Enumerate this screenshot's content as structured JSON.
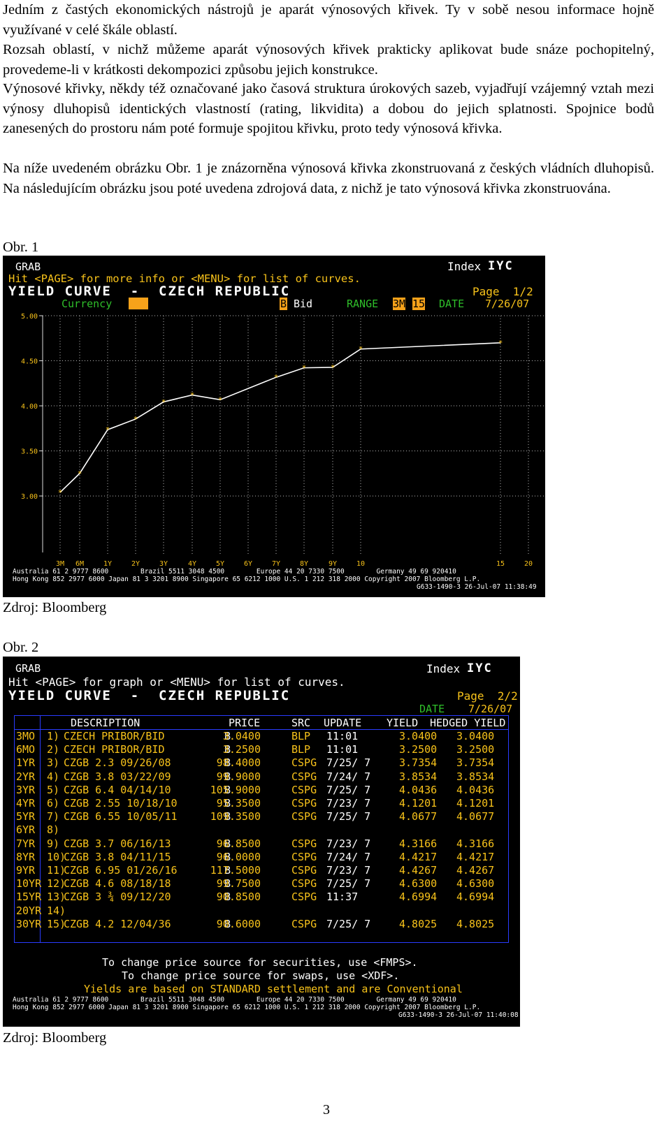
{
  "paragraphs": [
    "Jedním z častých ekonomických nástrojů je aparát výnosových křivek. Ty v sobě nesou informace hojně využívané v celé škále oblastí.",
    "Rozsah oblastí, v nichž můžeme aparát výnosových křivek prakticky aplikovat bude snáze pochopitelný, provedeme-li v krátkosti dekompozici způsobu jejich konstrukce.",
    "Výnosové křivky, někdy též označované jako časová struktura úrokových sazeb, vyjadřují vzájemný vztah mezi výnosy dluhopisů identických vlastností (rating, likvidita) a dobou do jejich splatnosti. Spojnice bodů zanesených do prostoru nám poté formuje spojitou křivku, proto tedy výnosová křivka.",
    "Na níže uvedeném obrázku Obr. 1 je znázorněna výnosová křivka zkonstruovaná z českých vládních dluhopisů. Na následujícím obrázku jsou poté uvedena zdrojová data, z nichž je tato výnosová křivka zkonstruována."
  ],
  "figure1": {
    "caption": "Obr. 1",
    "source": "Zdroj: Bloomberg",
    "grab": "GRAB",
    "index_label": "Index",
    "index_code": "IYC",
    "hint": "Hit <PAGE> for more info or <MENU> for list of curves.",
    "title": "YIELD CURVE  -  CZECH REPUBLIC",
    "currency_label": "Currency",
    "page_label": "Page  1/2",
    "bid_key": "B",
    "bid_label": "Bid",
    "range_label": "RANGE",
    "range_from": "3M",
    "range_to": "15",
    "date_label": "DATE",
    "date_value": "7/26/07",
    "footer1": "Australia 61 2 9777 8600        Brazil 5511 3048 4500        Europe 44 20 7330 7500        Germany 49 69 920410",
    "footer2": "Hong Kong 852 2977 6000 Japan 81 3 3201 8900 Singapore 65 6212 1000 U.S. 1 212 318 2000 Copyright 2007 Bloomberg L.P.",
    "footer3": "G633-1490-3 26-Jul-07 11:38:49",
    "colors": {
      "background": "#000000",
      "text": "#ffffff",
      "accent": "#f7c21a",
      "green": "#2fbf2a",
      "grid": "#b9b9b9"
    },
    "chart_data": {
      "type": "line",
      "title": "",
      "xlabel": "",
      "ylabel": "",
      "x_ticks": [
        "3M",
        "6M",
        "1Y",
        "2Y",
        "3Y",
        "4Y",
        "5Y",
        "6Y",
        "7Y",
        "8Y",
        "9Y",
        "10",
        "15",
        "20"
      ],
      "y_ticks": [
        "5.00",
        "4.50",
        "4.00",
        "3.50",
        "3.00"
      ],
      "ylim": [
        2.9,
        5.0
      ],
      "x": [
        "3M",
        "6M",
        "1Y",
        "2Y",
        "3Y",
        "4Y",
        "5Y",
        "7Y",
        "8Y",
        "9Y",
        "10",
        "15"
      ],
      "values": [
        3.04,
        3.25,
        3.7354,
        3.8534,
        4.0436,
        4.1201,
        4.0677,
        4.3166,
        4.4217,
        4.4267,
        4.63,
        4.6994
      ],
      "grid": true
    }
  },
  "figure2": {
    "caption": "Obr. 2",
    "source": "Zdroj: Bloomberg",
    "grab": "GRAB",
    "index_label": "Index",
    "index_code": "IYC",
    "hint": "Hit <PAGE> for graph or <MENU> for list of curves.",
    "title": "YIELD CURVE  -  CZECH REPUBLIC",
    "page_label": "Page  2/2",
    "date_label": "DATE",
    "date_value": "7/26/07",
    "headers": [
      "DESCRIPTION",
      "PRICE",
      "SRC",
      "UPDATE",
      "YIELD",
      "HEDGED YIELD"
    ],
    "rows": [
      {
        "term": "3MO",
        "num": "1)",
        "desc": "CZECH PRIBOR/BID",
        "b": "B",
        "price": "3.0400",
        "src": "BLP",
        "update": "11:01",
        "yield": "3.0400",
        "hedged": "3.0400"
      },
      {
        "term": "6MO",
        "num": "2)",
        "desc": "CZECH PRIBOR/BID",
        "b": "B",
        "price": "3.2500",
        "src": "BLP",
        "update": "11:01",
        "yield": "3.2500",
        "hedged": "3.2500"
      },
      {
        "term": "1YR",
        "num": "3)",
        "desc": "CZGB 2.3 09/26/08",
        "b": "B",
        "price": "98.4000",
        "src": "CSPG",
        "update": "7/25/ 7",
        "yield": "3.7354",
        "hedged": "3.7354"
      },
      {
        "term": "2YR",
        "num": "4)",
        "desc": "CZGB 3.8 03/22/09",
        "b": "B",
        "price": "99.9000",
        "src": "CSPG",
        "update": "7/24/ 7",
        "yield": "3.8534",
        "hedged": "3.8534"
      },
      {
        "term": "3YR",
        "num": "5)",
        "desc": "CZGB 6.4 04/14/10",
        "b": "B",
        "price": "105.9000",
        "src": "CSPG",
        "update": "7/25/ 7",
        "yield": "4.0436",
        "hedged": "4.0436"
      },
      {
        "term": "4YR",
        "num": "6)",
        "desc": "CZGB 2.55 10/18/10",
        "b": "B",
        "price": "95.3500",
        "src": "CSPG",
        "update": "7/23/ 7",
        "yield": "4.1201",
        "hedged": "4.1201"
      },
      {
        "term": "5YR",
        "num": "7)",
        "desc": "CZGB 6.55 10/05/11",
        "b": "B",
        "price": "109.3500",
        "src": "CSPG",
        "update": "7/25/ 7",
        "yield": "4.0677",
        "hedged": "4.0677"
      },
      {
        "term": "6YR",
        "num": "8)",
        "desc": "",
        "b": "",
        "price": "",
        "src": "",
        "update": "",
        "yield": "",
        "hedged": ""
      },
      {
        "term": "7YR",
        "num": "9)",
        "desc": "CZGB 3.7 06/16/13",
        "b": "B",
        "price": "96.8500",
        "src": "CSPG",
        "update": "7/23/ 7",
        "yield": "4.3166",
        "hedged": "4.3166"
      },
      {
        "term": "8YR",
        "num": "10)",
        "desc": "CZGB 3.8 04/11/15",
        "b": "B",
        "price": "96.0000",
        "src": "CSPG",
        "update": "7/24/ 7",
        "yield": "4.4217",
        "hedged": "4.4217"
      },
      {
        "term": "9YR",
        "num": "11)",
        "desc": "CZGB 6.95 01/26/16",
        "b": "B",
        "price": "117.5000",
        "src": "CSPG",
        "update": "7/23/ 7",
        "yield": "4.4267",
        "hedged": "4.4267"
      },
      {
        "term": "10YR",
        "num": "12)",
        "desc": "CZGB 4.6 08/18/18",
        "b": "B",
        "price": "99.7500",
        "src": "CSPG",
        "update": "7/25/ 7",
        "yield": "4.6300",
        "hedged": "4.6300"
      },
      {
        "term": "15YR",
        "num": "13)",
        "desc": "CZGB 3 ¾ 09/12/20",
        "b": "B",
        "price": "90.8500",
        "src": "CSPG",
        "update": "11:37",
        "yield": "4.6994",
        "hedged": "4.6994"
      },
      {
        "term": "20YR",
        "num": "14)",
        "desc": "",
        "b": "",
        "price": "",
        "src": "",
        "update": "",
        "yield": "",
        "hedged": ""
      },
      {
        "term": "30YR",
        "num": "15)",
        "desc": "CZGB 4.2 12/04/36",
        "b": "B",
        "price": "90.6000",
        "src": "CSPG",
        "update": "7/25/ 7",
        "yield": "4.8025",
        "hedged": "4.8025"
      }
    ],
    "note1": "To change price source for securities, use <FMPS>.",
    "note2": "To change price source for swaps, use <XDF>.",
    "note3": "Yields are based on STANDARD settlement and are Conventional",
    "footer1": "Australia 61 2 9777 8600        Brazil 5511 3048 4500        Europe 44 20 7330 7500        Germany 49 69 920410",
    "footer2": "Hong Kong 852 2977 6000 Japan 81 3 3201 8900 Singapore 65 6212 1000 U.S. 1 212 318 2000 Copyright 2007 Bloomberg L.P.",
    "footer3": "G633-1490-3 26-Jul-07 11:40:08"
  },
  "page_number": "3"
}
